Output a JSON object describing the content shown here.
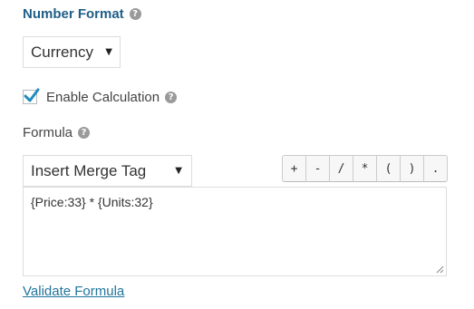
{
  "number_format": {
    "title": "Number Format",
    "help_icon": "question-circle-icon",
    "select_value": "Currency"
  },
  "enable_calculation": {
    "label": "Enable Calculation",
    "checked": true,
    "help_icon": "question-circle-icon"
  },
  "formula": {
    "label": "Formula",
    "help_icon": "question-circle-icon",
    "merge_tag_select": "Insert Merge Tag",
    "operators": [
      "+",
      "-",
      "/",
      "*",
      "(",
      ")",
      "."
    ],
    "value": "{Price:33} * {Units:32}"
  },
  "validate_link": "Validate Formula",
  "colors": {
    "title": "#1f5e87",
    "checkbox_tick": "#1e8cbe",
    "link": "#21759b"
  }
}
